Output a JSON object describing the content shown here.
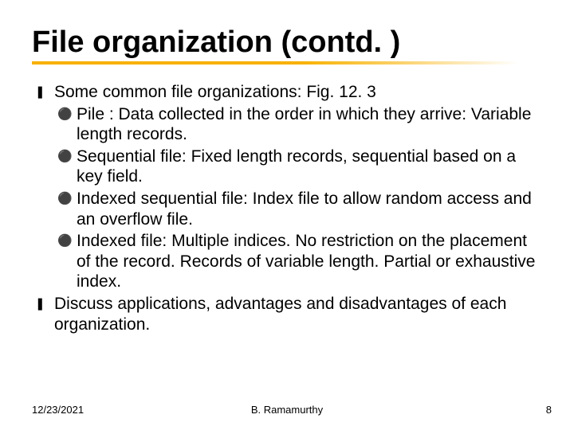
{
  "title": "File organization (contd. )",
  "bullets": {
    "intro": "Some common file organizations: Fig. 12. 3",
    "pile": "Pile : Data collected in the order in which they arrive: Variable length records.",
    "sequential": "Sequential file: Fixed length records, sequential based on a key field.",
    "indexed_seq": "Indexed sequential file: Index file to allow random access and an overflow file.",
    "indexed": "Indexed file: Multiple indices. No restriction on the placement of the record. Records of variable length. Partial or exhaustive index.",
    "discuss": "Discuss applications, advantages and disadvantages of each organization."
  },
  "footer": {
    "date": "12/23/2021",
    "author": "B. Ramamurthy",
    "page": "8"
  },
  "glyphs": {
    "l1": "❚",
    "l2": "⚫"
  }
}
